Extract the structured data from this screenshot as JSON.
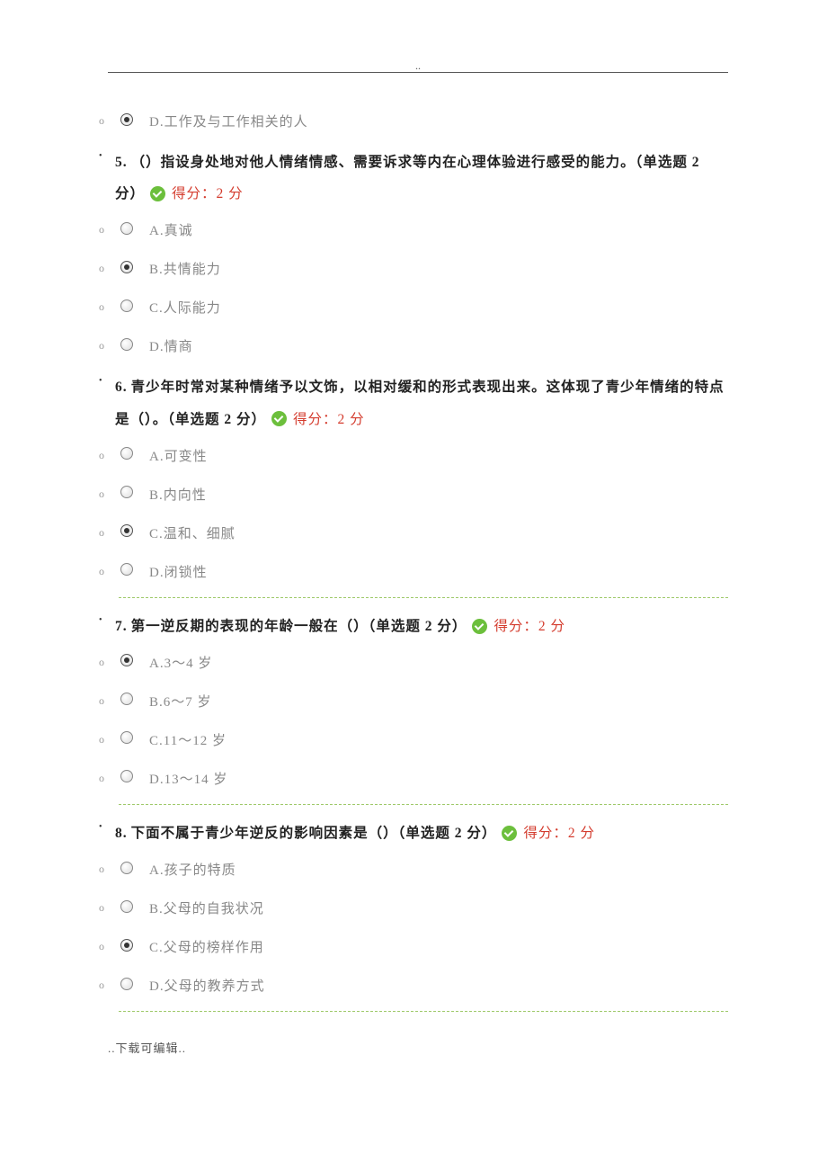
{
  "header_dots": "..",
  "footer_text": "..下载可编辑..",
  "score_prefix": "得分：",
  "score_suffix": " 分",
  "top_option": {
    "label": "D.工作及与工作相关的人",
    "selected": true
  },
  "questions": [
    {
      "number": "5.",
      "text_before": "（）指设身处地对他人情绪情感、需要诉求等内在心理体验进行感受的能力。（单选题 2 分）",
      "score": "2",
      "options": [
        {
          "label": "A.真诚",
          "selected": false
        },
        {
          "label": "B.共情能力",
          "selected": true
        },
        {
          "label": "C.人际能力",
          "selected": false
        },
        {
          "label": "D.情商",
          "selected": false
        }
      ]
    },
    {
      "number": "6.",
      "text_before": "青少年时常对某种情绪予以文饰，以相对缓和的形式表现出来。这体现了青少年情绪的特点是（）。（单选题 2 分）",
      "score": "2",
      "options": [
        {
          "label": "A.可变性",
          "selected": false
        },
        {
          "label": "B.内向性",
          "selected": false
        },
        {
          "label": "C.温和、细腻",
          "selected": true
        },
        {
          "label": "D.闭锁性",
          "selected": false
        }
      ]
    },
    {
      "number": "7.",
      "text_before": "第一逆反期的表现的年龄一般在（）（单选题 2 分）",
      "score": "2",
      "options": [
        {
          "label": "A.3～4 岁",
          "selected": true
        },
        {
          "label": "B.6～7 岁",
          "selected": false
        },
        {
          "label": "C.11～12 岁",
          "selected": false
        },
        {
          "label": "D.13～14 岁",
          "selected": false
        }
      ]
    },
    {
      "number": "8.",
      "text_before": "下面不属于青少年逆反的影响因素是（）（单选题 2 分）",
      "score": "2",
      "options": [
        {
          "label": "A.孩子的特质",
          "selected": false
        },
        {
          "label": "B.父母的自我状况",
          "selected": false
        },
        {
          "label": "C.父母的榜样作用",
          "selected": true
        },
        {
          "label": "D.父母的教养方式",
          "selected": false
        }
      ]
    }
  ]
}
